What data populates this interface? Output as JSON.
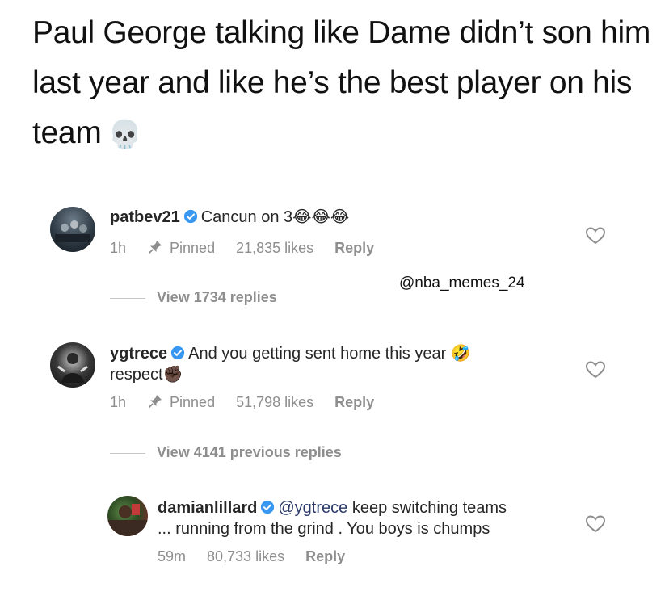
{
  "caption": {
    "text": "Paul George talking like Dame didn’t son him last year and like he’s the best player on his team",
    "emoji": "💀"
  },
  "comments": [
    {
      "username": "patbev21",
      "verified": true,
      "text": "Cancun on 3",
      "emoji": "😂😂😂",
      "time": "1h",
      "pinned_label": "Pinned",
      "likes": "21,835 likes",
      "reply_label": "Reply",
      "avatar_icon": "avatar-photo"
    },
    {
      "username": "ygtrece",
      "verified": true,
      "text": "And you getting sent home this year",
      "emoji": "🤣",
      "text2": "respect",
      "emoji2": "✊🏿",
      "time": "1h",
      "pinned_label": "Pinned",
      "likes": "51,798 likes",
      "reply_label": "Reply",
      "avatar_icon": "avatar-photo"
    },
    {
      "username": "damianlillard",
      "verified": true,
      "mention": "@ygtrece",
      "text": "keep switching teams",
      "text2": "... running from the grind . You boys is chumps",
      "time": "59m",
      "likes": "80,733 likes",
      "reply_label": "Reply",
      "avatar_icon": "avatar-photo"
    }
  ],
  "view_replies_1": "View 1734 replies",
  "view_replies_2": "View 4141 previous replies",
  "watermark": "@nba_memes_24",
  "colors": {
    "verified_blue": "#3897f0",
    "meta_gray": "#8e8e8e",
    "text_dark": "#262626"
  }
}
